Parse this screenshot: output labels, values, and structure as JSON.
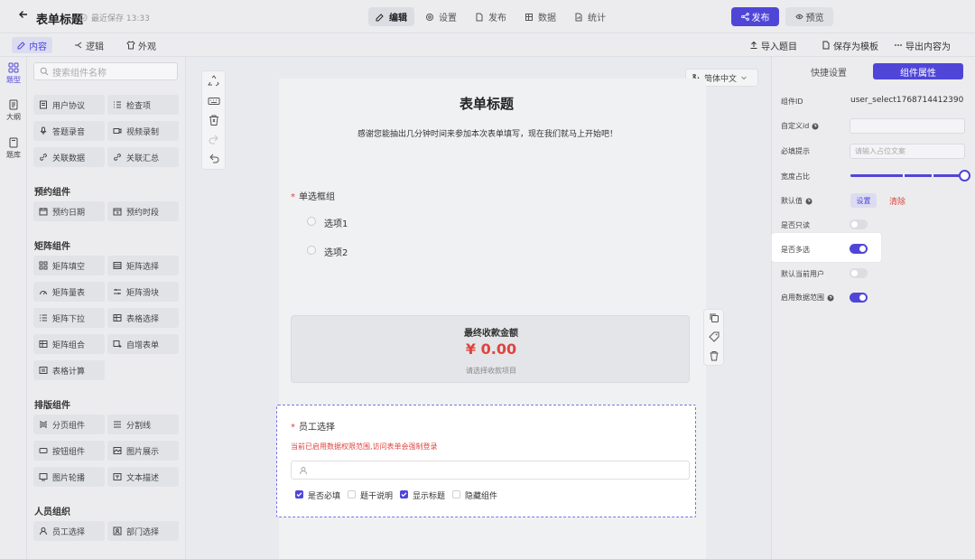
{
  "header": {
    "title": "表单标题",
    "save_status": "最近保存 13:33",
    "tabs": [
      {
        "label": "编辑",
        "icon": "edit-icon",
        "active": true
      },
      {
        "label": "设置",
        "icon": "gear-icon",
        "active": false
      },
      {
        "label": "发布",
        "icon": "document-icon",
        "active": false
      },
      {
        "label": "数据",
        "icon": "data-icon",
        "active": false
      },
      {
        "label": "统计",
        "icon": "stats-icon",
        "active": false
      }
    ],
    "publish": "发布",
    "preview": "预览"
  },
  "subbar": {
    "tabs": [
      {
        "label": "内容",
        "icon": "edit-icon",
        "active": true
      },
      {
        "label": "逻辑",
        "icon": "logic-icon",
        "active": false
      },
      {
        "label": "外观",
        "icon": "shirt-icon",
        "active": false
      }
    ],
    "actions": {
      "import": "导入题目",
      "save_template": "保存为模板",
      "export": "导出内容为"
    }
  },
  "rail": [
    {
      "label": "题型",
      "icon": "grid-icon",
      "active": true
    },
    {
      "label": "大纲",
      "icon": "outline-icon",
      "active": false
    },
    {
      "label": "题库",
      "icon": "library-icon",
      "active": false
    }
  ],
  "panel": {
    "search_placeholder": "搜索组件名称",
    "top_items": [
      "用户协议",
      "检查项",
      "答题录音",
      "视频录制",
      "关联数据",
      "关联汇总"
    ],
    "groups": [
      {
        "title": "预约组件",
        "items": [
          "预约日期",
          "预约时段"
        ]
      },
      {
        "title": "矩阵组件",
        "items": [
          "矩阵填空",
          "矩阵选择",
          "矩阵量表",
          "矩阵滑块",
          "矩阵下拉",
          "表格选择",
          "矩阵组合",
          "自增表单",
          "表格计算"
        ]
      },
      {
        "title": "排版组件",
        "items": [
          "分页组件",
          "分割线",
          "按钮组件",
          "图片展示",
          "图片轮播",
          "文本描述"
        ]
      },
      {
        "title": "人员组织",
        "items": [
          "员工选择",
          "部门选择"
        ]
      }
    ]
  },
  "canvas": {
    "language": "简体中文",
    "form_title": "表单标题",
    "form_desc": "感谢您能抽出几分钟时间来参加本次表单填写，现在我们就马上开始吧！",
    "radio_question": {
      "required": "*",
      "label": "单选框组",
      "options": [
        "选项1",
        "选项2"
      ]
    },
    "payment": {
      "label": "最终收款金额",
      "amount": "¥ 0.00",
      "hint": "请选择收款项目"
    },
    "employee": {
      "required": "*",
      "label": "员工选择",
      "warning": "当前已启用数据权限范围,访问表单会强制登录",
      "checks": [
        {
          "label": "是否必填",
          "checked": true
        },
        {
          "label": "题干说明",
          "checked": false
        },
        {
          "label": "显示标题",
          "checked": true
        },
        {
          "label": "隐藏组件",
          "checked": false
        }
      ]
    }
  },
  "props": {
    "tabs": {
      "quick": "快捷设置",
      "attrs": "组件属性"
    },
    "component_id_label": "组件ID",
    "component_id_value": "user_select1768714412390",
    "custom_id_label": "自定义id",
    "placeholder_label": "必填提示",
    "placeholder_hint": "请输入占位文案",
    "width_label": "宽度占比",
    "width_fraction": 1.0,
    "default_label": "默认值",
    "default_set": "设置",
    "default_clear": "清除",
    "readonly_label": "是否只读",
    "readonly_on": false,
    "multi_label": "是否多选",
    "multi_on": true,
    "current_user_label": "默认当前用户",
    "current_user_on": false,
    "data_scope_label": "启用数据范围",
    "data_scope_on": true
  },
  "colors": {
    "accent": "#4f46d8",
    "danger": "#e0443e"
  }
}
